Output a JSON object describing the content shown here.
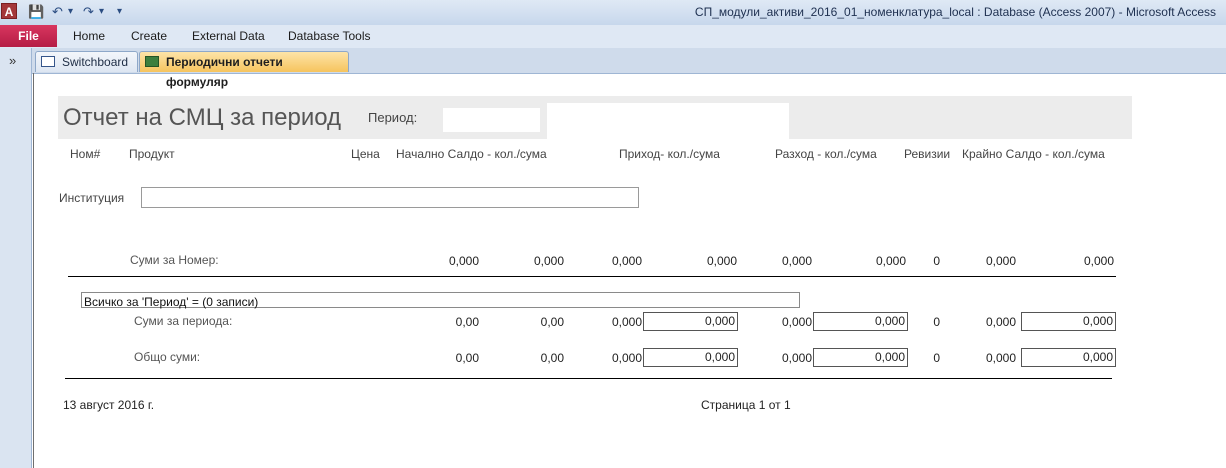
{
  "titlebar": {
    "icon_letter": "A",
    "qat_save": "💾",
    "qat_undo": "↶",
    "qat_redo": "↷",
    "qat_more": "▾",
    "window_title": "СП_модули_активи_2016_01_номенклатура_local : Database (Access 2007)  -  Microsoft Access"
  },
  "ribbon": {
    "file": "File",
    "tabs": [
      "Home",
      "Create",
      "External Data",
      "Database Tools"
    ]
  },
  "nav": {
    "toggle": "»"
  },
  "doc_tabs": [
    {
      "label": "Switchboard"
    },
    {
      "label": "Периодични отчети формуляр"
    }
  ],
  "report": {
    "title": "Отчет на СМЦ за период",
    "period_label": "Период:",
    "columns": {
      "nom": "Ном#",
      "product": "Продукт",
      "price": "Цена",
      "opening": "Начално Салдо - кол./сума",
      "income": "Приход- кол./сума",
      "expense": "Разход - кол./сума",
      "revisions": "Ревизии",
      "closing": "Крайно Салдо - кол./сума"
    },
    "institution_label": "Институция",
    "sum_by_number": {
      "label": "Суми за Номер:",
      "values": [
        "0,000",
        "0,000",
        "0,000",
        "0,000",
        "0,000",
        "0,000",
        "0",
        "0,000",
        "0,000"
      ]
    },
    "total_line": "Всичко за 'Период' =  (0 записи)",
    "sum_by_period": {
      "label": "Суми за периода:",
      "values": [
        "0,00",
        "0,00",
        "0,000",
        "0,000",
        "0,000",
        "0,000",
        "0",
        "0,000",
        "0,000"
      ]
    },
    "grand_total": {
      "label": "Общо суми:",
      "values": [
        "0,00",
        "0,00",
        "0,000",
        "0,000",
        "0,000",
        "0,000",
        "0",
        "0,000",
        "0,000"
      ]
    },
    "footer_date": "13 август 2016 г.",
    "footer_page": "Страница 1 от 1"
  }
}
